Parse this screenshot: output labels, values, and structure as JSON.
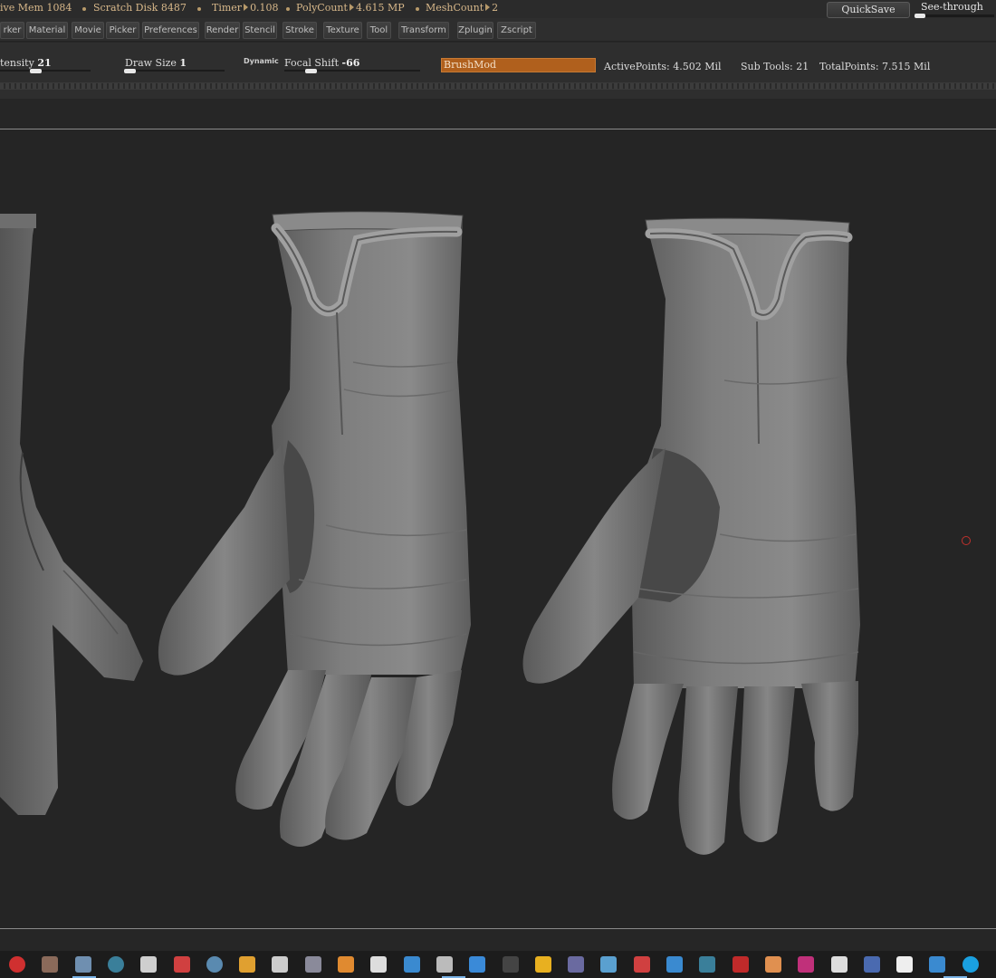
{
  "statusbar": {
    "active_mem": "ive Mem 1084",
    "scratch_disk": "Scratch Disk 8487",
    "timer_label": "Timer",
    "timer_value": "0.108",
    "polycount_label": "PolyCount",
    "polycount_value": "4.615 MP",
    "meshcount_label": "MeshCount",
    "meshcount_value": "2",
    "quicksave": "QuickSave",
    "see_through": "See-through",
    "see_through_level": 0
  },
  "menu": {
    "items": [
      "rker",
      "Material",
      "Movie",
      "Picker",
      "Preferences",
      "Render",
      "Stencil",
      "Stroke",
      "Texture",
      "Tool",
      "Transform",
      "Zplugin",
      "Zscript"
    ]
  },
  "shelf": {
    "intensity_label": "tensity",
    "intensity_value": "21",
    "draw_size_label": "Draw Size",
    "draw_size_value": "1",
    "dynamic_label": "Dynamic",
    "focal_shift_label": "Focal Shift",
    "focal_shift_value": "-66",
    "brushmod": "BrushMod",
    "active_points": "ActivePoints: 4.502 Mil",
    "sub_tools": "Sub Tools: 21",
    "total_points": "TotalPoints: 7.515 Mil"
  },
  "taskbar": {
    "icons": [
      {
        "name": "record-icon",
        "color": "#d03030"
      },
      {
        "name": "app-icon",
        "color": "#8a6a5a"
      },
      {
        "name": "explorer-icon",
        "color": "#6f8fb0"
      },
      {
        "name": "globe-icon",
        "color": "#3a7f9a"
      },
      {
        "name": "fan-icon",
        "color": "#cfcfcf"
      },
      {
        "name": "app-icon",
        "color": "#d04040"
      },
      {
        "name": "steam-icon",
        "color": "#5a8ab0"
      },
      {
        "name": "app-icon",
        "color": "#e0a030"
      },
      {
        "name": "app-icon",
        "color": "#cccccc"
      },
      {
        "name": "app-icon",
        "color": "#8a8a9a"
      },
      {
        "name": "app-icon",
        "color": "#e08a30"
      },
      {
        "name": "unity-icon",
        "color": "#dddddd"
      },
      {
        "name": "app-icon",
        "color": "#3a8ad0"
      },
      {
        "name": "app-icon",
        "color": "#bbbbbb"
      },
      {
        "name": "vscode-icon",
        "color": "#3a8ad8"
      },
      {
        "name": "app-icon",
        "color": "#444444"
      },
      {
        "name": "app-icon",
        "color": "#e8b020"
      },
      {
        "name": "after-effects-icon",
        "color": "#6a6aa0"
      },
      {
        "name": "app-icon",
        "color": "#5aa0d0"
      },
      {
        "name": "app-icon",
        "color": "#d04040"
      },
      {
        "name": "app-icon",
        "color": "#3a8ad0"
      },
      {
        "name": "app-icon",
        "color": "#3a7f9a"
      },
      {
        "name": "app-icon",
        "color": "#c02a2a"
      },
      {
        "name": "app-icon",
        "color": "#e09050"
      },
      {
        "name": "indesign-icon",
        "color": "#c0307a"
      },
      {
        "name": "unity-icon",
        "color": "#dddddd"
      },
      {
        "name": "app-icon",
        "color": "#4a6ab0"
      },
      {
        "name": "file-icon",
        "color": "#eeeeee"
      },
      {
        "name": "app-icon",
        "color": "#3a8ad0"
      },
      {
        "name": "skype-icon",
        "color": "#1aa0e0"
      }
    ]
  }
}
